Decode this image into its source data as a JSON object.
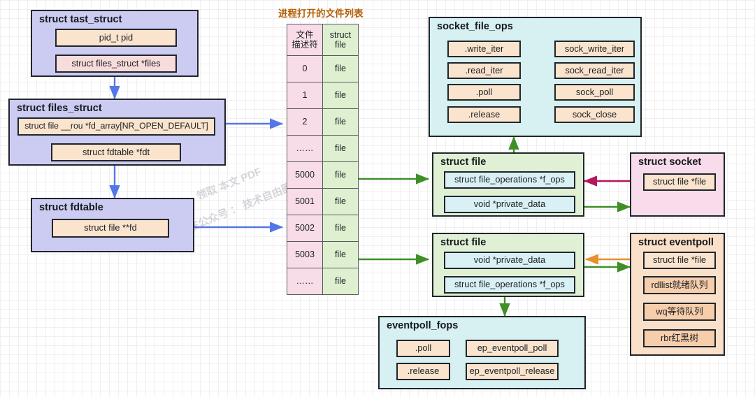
{
  "watermark": {
    "line1": "领取 本文 PDF",
    "line2": "关注公众号 ： 技术自由圈"
  },
  "task_struct": {
    "title": "struct tast_struct",
    "fields": [
      {
        "label": "pid_t pid"
      },
      {
        "label": "struct files_struct *files"
      }
    ]
  },
  "files_struct": {
    "title": "struct files_struct",
    "fields": [
      {
        "label": "struct file __rou *fd_array[NR_OPEN_DEFAULT]"
      },
      {
        "label": "struct fdtable *fdt"
      }
    ]
  },
  "fdtable_struct": {
    "title": "struct fdtable",
    "fields": [
      {
        "label": "struct file **fd"
      }
    ]
  },
  "fd_table": {
    "title": "进程打开的文件列表",
    "headers": [
      "文件\n描述符",
      "struct\nfile"
    ],
    "header_col1_line1": "文件",
    "header_col1_line2": "描述符",
    "header_col2_line1": "struct",
    "header_col2_line2": "file",
    "rows": [
      {
        "fd": "0",
        "file": "file"
      },
      {
        "fd": "1",
        "file": "file"
      },
      {
        "fd": "2",
        "file": "file"
      },
      {
        "fd": "……",
        "file": "file"
      },
      {
        "fd": "5000",
        "file": "file"
      },
      {
        "fd": "5001",
        "file": "file"
      },
      {
        "fd": "5002",
        "file": "file"
      },
      {
        "fd": "5003",
        "file": "file"
      },
      {
        "fd": "……",
        "file": "file"
      }
    ]
  },
  "socket_file_ops": {
    "title": "socket_file_ops",
    "ops": [
      {
        "name": ".write_iter",
        "impl": "sock_write_iter"
      },
      {
        "name": ".read_iter",
        "impl": "sock_read_iter"
      },
      {
        "name": ".poll",
        "impl": "sock_poll"
      },
      {
        "name": ".release",
        "impl": "sock_close"
      }
    ]
  },
  "file_socket": {
    "title": "struct file",
    "fields": [
      {
        "label": "struct file_operations *f_ops"
      },
      {
        "label": "void *private_data"
      }
    ]
  },
  "socket": {
    "title": "struct socket",
    "fields": [
      {
        "label": "struct file *file"
      }
    ]
  },
  "file_eventpoll": {
    "title": "struct file",
    "fields": [
      {
        "label": "void *private_data"
      },
      {
        "label": "struct file_operations *f_ops"
      }
    ]
  },
  "eventpoll": {
    "title": "struct eventpoll",
    "fields": [
      {
        "label": "struct file *file"
      },
      {
        "label": "rdllist就绪队列"
      },
      {
        "label": "wq等待队列"
      },
      {
        "label": "rbr红黑树"
      }
    ]
  },
  "eventpoll_fops": {
    "title": "eventpoll_fops",
    "ops": [
      {
        "name": ".poll",
        "impl": "ep_eventpoll_poll"
      },
      {
        "name": ".release",
        "impl": "ep_eventpoll_release"
      }
    ]
  },
  "colors": {
    "arrow_blue": "#5576e8",
    "arrow_green": "#3f8f29",
    "arrow_orange": "#e8902c",
    "arrow_magenta": "#b5175e",
    "arrow_black": "#1c1f24",
    "title_orange": "#b45f06"
  }
}
